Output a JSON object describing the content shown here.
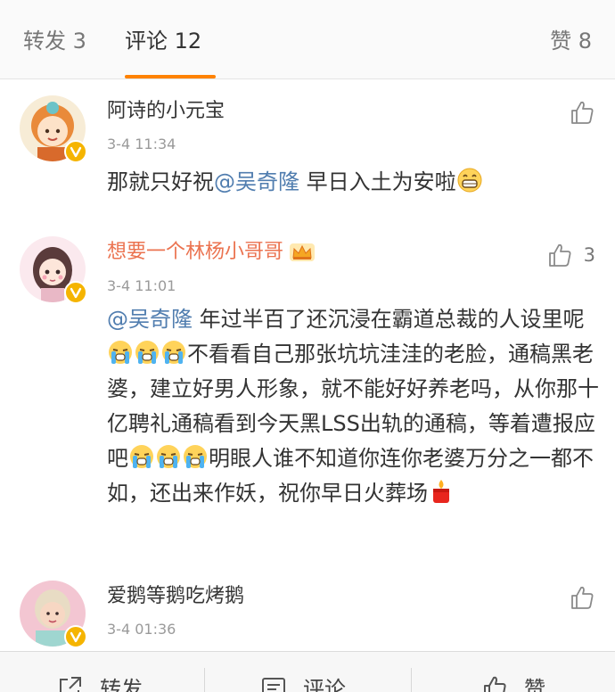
{
  "tabs": {
    "repost": "转发 3",
    "comment": "评论 12",
    "like": "赞 8"
  },
  "comments": [
    {
      "username": "阿诗的小元宝",
      "time": "3-4 11:34",
      "like_count": "",
      "text_before": "那就只好祝",
      "mention": "@吴奇隆",
      "text_after": " 早日入土为安啦"
    },
    {
      "username": "想要一个林杨小哥哥",
      "time": "3-4 11:01",
      "like_count": "3",
      "mention": "@吴奇隆",
      "text_a": " 年过半百了还沉浸在霸道总裁的人设里呢",
      "text_b": "不看看自己那张坑坑洼洼的老脸，通稿黑老婆，建立好男人形象，就不能好好养老吗，从你那十亿聘礼通稿看到今天黑LSS出轨的通稿，等着遭报应吧",
      "text_c": "明眼人谁不知道你连你老婆万分之一都不如，还出来作妖，祝你早日火葬场"
    },
    {
      "username": "爱鹅等鹅吃烤鹅",
      "time": "3-4 01:36",
      "like_count": ""
    }
  ],
  "bottom_bar": {
    "repost": "转发",
    "comment": "评论",
    "like": "赞"
  },
  "colors": {
    "accent": "#ff8200",
    "mention": "#507daf",
    "vip_name": "#eb7350",
    "verified_badge": "#f5b400"
  },
  "icons": [
    "thumb-up-icon",
    "verified-badge-icon",
    "crown-icon",
    "grin-emoji-icon",
    "crying-emoji-icon",
    "candle-emoji-icon",
    "repost-icon",
    "comment-icon"
  ]
}
